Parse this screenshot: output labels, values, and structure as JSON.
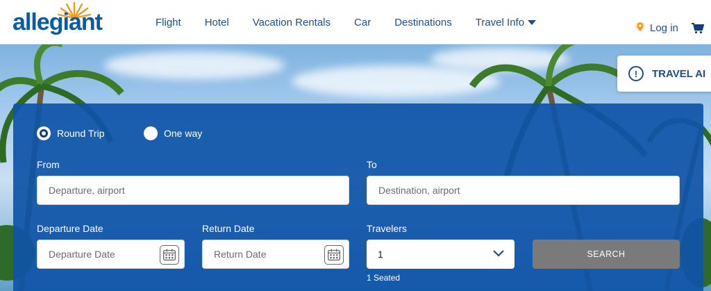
{
  "brand": {
    "logo_text": "allegiant",
    "accent": "#0a5aa8",
    "sun_color": "#f39a1e"
  },
  "nav": {
    "items": [
      {
        "label": "Flight"
      },
      {
        "label": "Hotel"
      },
      {
        "label": "Vacation Rentals"
      },
      {
        "label": "Car"
      },
      {
        "label": "Destinations"
      },
      {
        "label": "Travel Info",
        "has_dropdown": true
      }
    ],
    "login_label": "Log in",
    "login_icon": "location-pin-icon",
    "cart_icon": "cart-icon"
  },
  "alert": {
    "label": "TRAVEL AI",
    "icon": "info-icon"
  },
  "booking": {
    "trip_type": [
      {
        "label": "Round Trip",
        "selected": true
      },
      {
        "label": "One way",
        "selected": false
      }
    ],
    "from": {
      "label": "From",
      "placeholder": "Departure, airport",
      "value": ""
    },
    "to": {
      "label": "To",
      "placeholder": "Destination, airport",
      "value": ""
    },
    "departure_date": {
      "label": "Departure Date",
      "placeholder": "Departure Date",
      "value": ""
    },
    "return_date": {
      "label": "Return Date",
      "placeholder": "Return Date",
      "value": ""
    },
    "travelers": {
      "label": "Travelers",
      "value": "1",
      "note": "1 Seated"
    },
    "search_label": "SEARCH",
    "panel_color": "#0e54a8",
    "search_color": "#7a7a7a"
  }
}
